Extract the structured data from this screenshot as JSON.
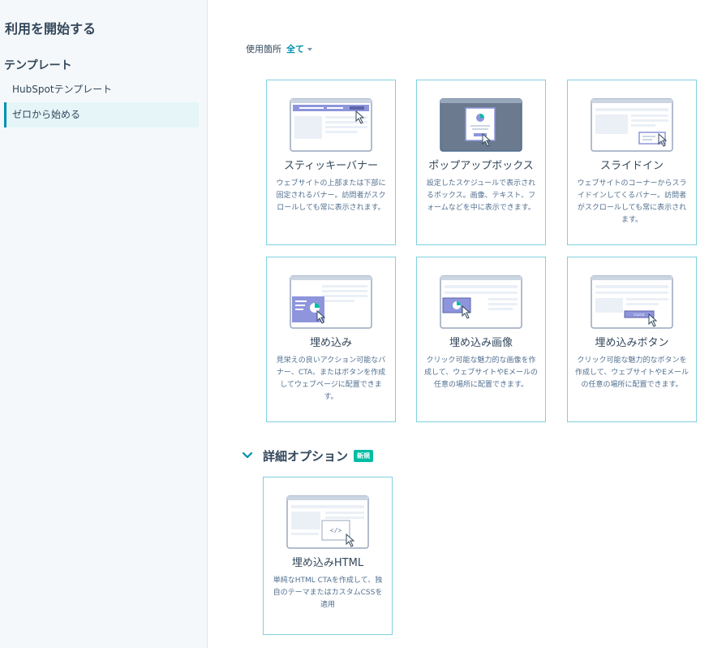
{
  "sidebar": {
    "title": "利用を開始する",
    "section": "テンプレート",
    "items": [
      {
        "label": "HubSpotテンプレート"
      },
      {
        "label": "ゼロから始める"
      }
    ]
  },
  "filter": {
    "label": "使用箇所",
    "value": "全て"
  },
  "cards": [
    {
      "title": "スティッキーバナー",
      "desc": "ウェブサイトの上部または下部に固定されるバナー。訪問者がスクロールしても常に表示されます。"
    },
    {
      "title": "ポップアップボックス",
      "desc": "設定したスケジュールで表示されるボックス。画像、テキスト、フォームなどを中に表示できます。"
    },
    {
      "title": "スライドイン",
      "desc": "ウェブサイトのコーナーからスライドインしてくるバナー。訪問者がスクロールしても常に表示されます。"
    },
    {
      "title": "埋め込み",
      "desc": "見栄えの良いアクション可能なバナー、CTA、またはボタンを作成してウェブページに配置できます。"
    },
    {
      "title": "埋め込み画像",
      "desc": "クリック可能な魅力的な画像を作成して、ウェブサイトやEメールの任意の場所に配置できます。"
    },
    {
      "title": "埋め込みボタン",
      "desc": "クリック可能な魅力的なボタンを作成して、ウェブサイトやEメールの任意の場所に配置できます。"
    }
  ],
  "advanced": {
    "title": "詳細オプション",
    "badge": "新規",
    "card": {
      "title": "埋め込みHTML",
      "desc": "単純なHTML CTAを作成して、独自のテーマまたはカスタムCSSを適用",
      "code_glyph": "</>"
    }
  },
  "button_glyph": "CLICK",
  "colors": {
    "accent": "#0091ae",
    "card_border": "#7fd1de",
    "badge": "#00bda5",
    "illustration_purple": "#8e95dc"
  }
}
